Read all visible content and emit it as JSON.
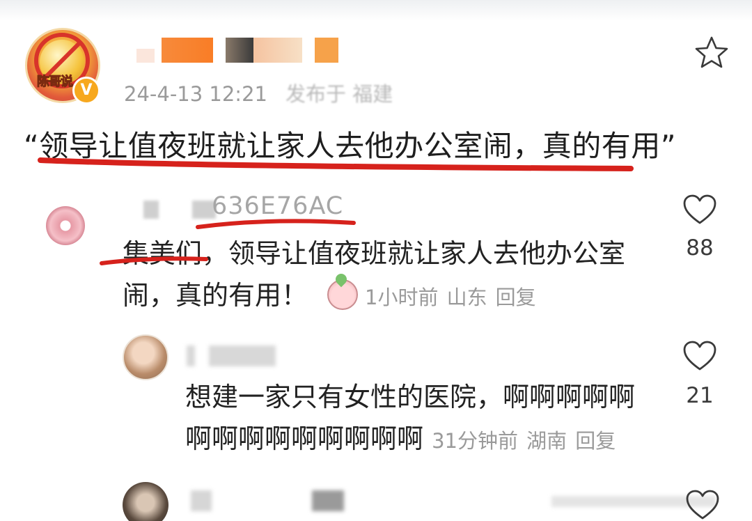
{
  "post": {
    "avatar_text": "陈哥说",
    "verified_badge": "V",
    "timestamp": "24-4-13 12:21",
    "location_text": "发布于 福建",
    "body": "“领导让值夜班就让家人去他办公室闹，真的有用”"
  },
  "comments": [
    {
      "username": "636E76AC",
      "body": "集美们，领导让值夜班就让家人去他办公室闹，真的有用！",
      "time": "1小时前",
      "location": "山东",
      "reply_label": "回复",
      "likes": "88"
    }
  ],
  "reply": {
    "body": "想建一家只有女性的医院，啊啊啊啊啊啊啊啊啊啊啊啊啊啊",
    "time": "31分钟前",
    "location": "湖南",
    "reply_label": "回复",
    "likes": "21"
  },
  "colors": {
    "annotation_red": "#d6221c",
    "meta_gray": "#9a9a9a",
    "text_dark": "#222222"
  },
  "icons": [
    "star-icon",
    "heart-outline-icon",
    "emoji-sticker-icon",
    "verified-badge-icon"
  ]
}
